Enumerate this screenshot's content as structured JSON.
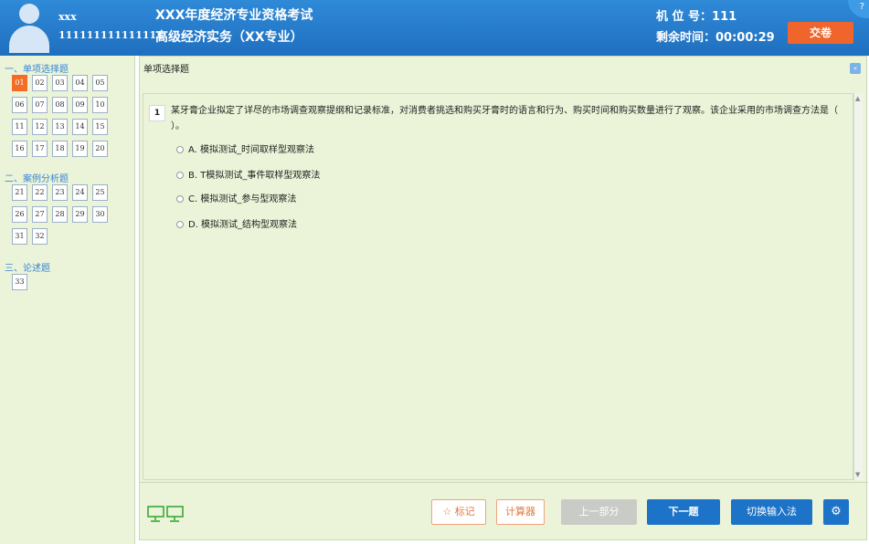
{
  "header": {
    "user_name": "xxx",
    "user_id": "111111111111111",
    "exam_title": "XXX年度经济专业资格考试",
    "exam_subtitle": "高级经济实务（XX专业）",
    "machine_no": "机 位 号：111",
    "time_left": "剩余时间：00:00:29",
    "submit_label": "交卷",
    "help_label": "?"
  },
  "sidebar": {
    "sections": [
      {
        "title": "一、单项选择题",
        "questions": [
          "01",
          "02",
          "03",
          "04",
          "05",
          "06",
          "07",
          "08",
          "09",
          "10",
          "11",
          "12",
          "13",
          "14",
          "15",
          "16",
          "17",
          "18",
          "19",
          "20"
        ]
      },
      {
        "title": "二、案例分析题",
        "questions": [
          "21",
          "22",
          "23",
          "24",
          "25",
          "26",
          "27",
          "28",
          "29",
          "30",
          "31",
          "32"
        ]
      },
      {
        "title": "三、论述题",
        "questions": [
          "33"
        ]
      }
    ],
    "active_question": "01"
  },
  "main": {
    "section_title": "单项选择题",
    "collapse_label": "«",
    "question": {
      "number": "1",
      "text": "某牙膏企业拟定了详尽的市场调查观察提纲和记录标准，对消费者挑选和购买牙膏时的语言和行为、购买时间和购买数量进行了观察。该企业采用的市场调查方法是（ ）。",
      "options": [
        "A. 模拟测试_时间取样型观察法",
        "B. T模拟测试_事件取样型观察法",
        "C. 模拟测试_参与型观察法",
        "D. 模拟测试_结构型观察法"
      ]
    }
  },
  "toolbar": {
    "mark_label": "标记",
    "calc_label": "计算器",
    "prev_label": "上一部分",
    "next_label": "下一题",
    "ime_label": "切换输入法"
  },
  "colors": {
    "header_blue": "#1f6fbf",
    "accent_orange": "#f0652b",
    "panel_green": "#ebf4d8",
    "button_blue": "#1c73c8"
  }
}
